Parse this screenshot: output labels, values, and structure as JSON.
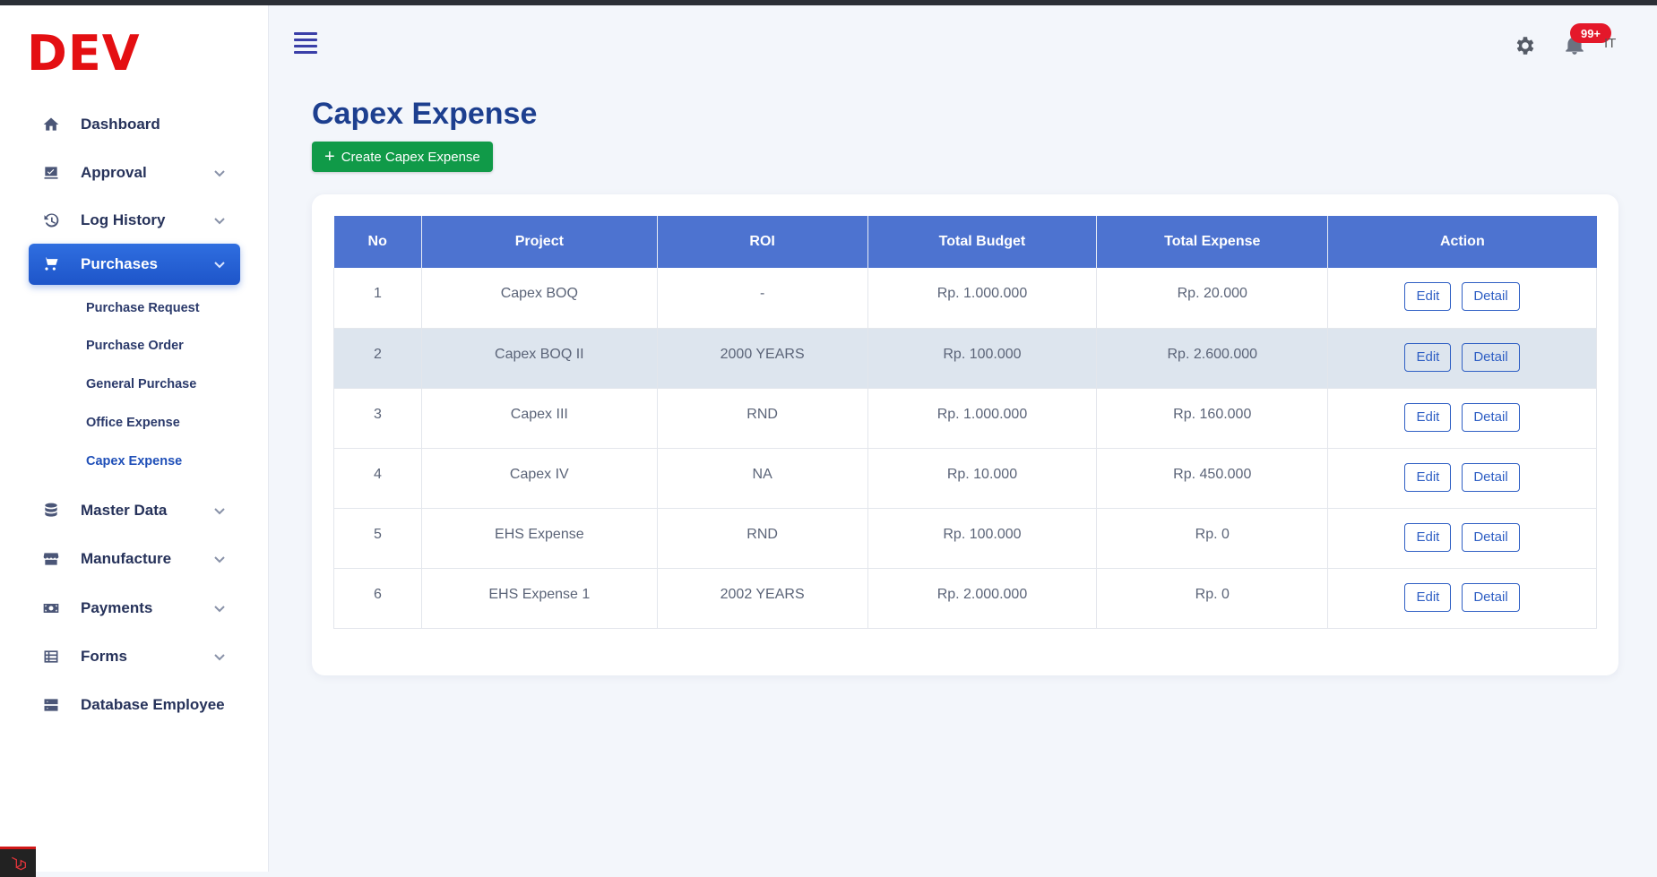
{
  "app": {
    "brand": "DEV"
  },
  "sidebar": {
    "items": [
      {
        "label": "Dashboard",
        "icon": "home-icon"
      },
      {
        "label": "Approval",
        "icon": "approval-icon"
      },
      {
        "label": "Log History",
        "icon": "history-icon"
      },
      {
        "label": "Purchases",
        "icon": "cart-icon",
        "active": true
      },
      {
        "label": "Master Data",
        "icon": "database-icon"
      },
      {
        "label": "Manufacture",
        "icon": "store-icon"
      },
      {
        "label": "Payments",
        "icon": "money-icon"
      },
      {
        "label": "Forms",
        "icon": "table-icon"
      },
      {
        "label": "Database Employee",
        "icon": "server-icon"
      }
    ],
    "purchases_sub": [
      {
        "label": "Purchase Request"
      },
      {
        "label": "Purchase Order"
      },
      {
        "label": "General Purchase"
      },
      {
        "label": "Office Expense"
      },
      {
        "label": "Capex Expense",
        "current": true
      }
    ]
  },
  "header": {
    "notification_count": "99+",
    "user_initials": "IT"
  },
  "main": {
    "title": "Capex Expense",
    "create_button": "Create Capex Expense",
    "table": {
      "columns": [
        "No",
        "Project",
        "ROI",
        "Total Budget",
        "Total Expense",
        "Action"
      ],
      "rows": [
        {
          "no": "1",
          "project": "Capex BOQ",
          "roi": "-",
          "budget": "Rp. 1.000.000",
          "expense": "Rp. 20.000"
        },
        {
          "no": "2",
          "project": "Capex BOQ II",
          "roi": "2000 YEARS",
          "budget": "Rp. 100.000",
          "expense": "Rp. 2.600.000"
        },
        {
          "no": "3",
          "project": "Capex III",
          "roi": "RND",
          "budget": "Rp. 1.000.000",
          "expense": "Rp. 160.000"
        },
        {
          "no": "4",
          "project": "Capex IV",
          "roi": "NA",
          "budget": "Rp. 10.000",
          "expense": "Rp. 450.000"
        },
        {
          "no": "5",
          "project": "EHS Expense",
          "roi": "RND",
          "budget": "Rp. 100.000",
          "expense": "Rp. 0"
        },
        {
          "no": "6",
          "project": "EHS Expense 1",
          "roi": "2002 YEARS",
          "budget": "Rp. 2.000.000",
          "expense": "Rp. 0"
        }
      ],
      "edit_label": "Edit",
      "detail_label": "Detail"
    }
  },
  "colors": {
    "brand": "#e40f12",
    "primary": "#1e55c9",
    "table_header": "#4d73d0",
    "create": "#109a48",
    "badge": "#e4182a"
  }
}
